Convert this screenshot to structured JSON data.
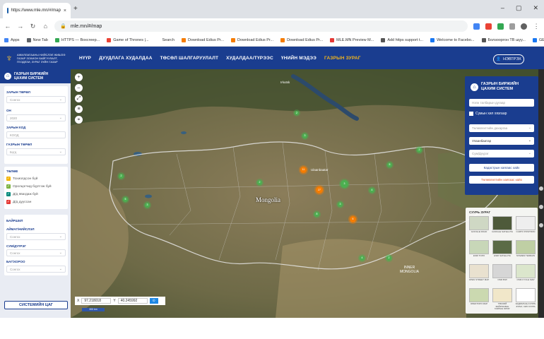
{
  "browser": {
    "tab_title": "https://www.mle.mn/#/map",
    "url": "mle.mn/#/map",
    "new_tab": "+",
    "bookmarks": [
      {
        "label": "Apps",
        "color": "#4285f4"
      },
      {
        "label": "New Tab",
        "color": "#5f6368"
      },
      {
        "label": "HTTPS — Boxcreep...",
        "color": "#34a853"
      },
      {
        "label": "Game of Thrones |...",
        "color": "#ea4335"
      },
      {
        "label": "Search",
        "color": "#ffffff"
      },
      {
        "label": "Download Edius Pr...",
        "color": "#f57c00"
      },
      {
        "label": "Download Edius Pr...",
        "color": "#f57c00"
      },
      {
        "label": "Download Edius Pr...",
        "color": "#f57c00"
      },
      {
        "label": "MLE.MN Preview M...",
        "color": "#e53935"
      },
      {
        "label": "Add https support t...",
        "color": "#555555"
      },
      {
        "label": "Welcome to Facebo...",
        "color": "#1877f2"
      },
      {
        "label": "Болзооргон ТВ шуу...",
        "color": "#555555"
      },
      {
        "label": "GEEKS",
        "color": "#1877f2"
      },
      {
        "label": "Other bookmarks",
        "color": "#f4b400"
      }
    ]
  },
  "site": {
    "logo_lines": [
      "АЖИЛЛАГААНЫ НИЙСЛЭЛ ЖИШЭЭ",
      "ГАЗАР ЗОХИОН БАЙГУУЛАЛТ,",
      "ГЕОДЕЗИ, ЗУРАГ ЗҮЙН ГАЗАР"
    ],
    "nav": [
      {
        "label": "НҮҮР",
        "active": false
      },
      {
        "label": "ДУУДЛАГА ХУДАЛДАА",
        "active": false
      },
      {
        "label": "ТӨСӨЛ ШАЛГАРУУЛАЛТ",
        "active": false
      },
      {
        "label": "ХУДАЛДАА/ТҮРЭЭС",
        "active": false
      },
      {
        "label": "ҮНИЙН МЭДЭЭ",
        "active": false
      },
      {
        "label": "ГАЗРЫН ЗУРАГ",
        "active": true
      }
    ],
    "login_label": "НЭВТРЭХ"
  },
  "sidebar": {
    "title_line1": "ГАЗРЫН БИРЖИЙН",
    "title_line2": "ЦАХИМ СИСТЕМ",
    "filters": [
      {
        "label": "ЗАРЫН ТӨРӨЛ",
        "value": "Сонгох"
      },
      {
        "label": "ОН",
        "value": "2020"
      },
      {
        "label": "ЗАРЫН КОД",
        "value": "КООД"
      },
      {
        "label": "ГАЗРЫН ТӨРӨЛ",
        "value": "Бүгд"
      }
    ],
    "layers_title": "ТӨЛӨВ",
    "layers": [
      {
        "label": "Тохиолдсон бүй",
        "color": "#f4b400"
      },
      {
        "label": "Оролцогчид бүртгэж буй",
        "color": "#7cb342"
      },
      {
        "label": "Д/д явагдаж буй",
        "color": "#00897b"
      },
      {
        "label": "Д/д дууссан",
        "color": "#e53935"
      }
    ],
    "location_title": "БАЙРШИЛ",
    "location_filters": [
      {
        "label": "АЙМАГ/НИЙСЛЭЛ",
        "value": "Сонгох"
      },
      {
        "label": "СУМ/ДҮҮРЭГ",
        "value": "Сонгох"
      },
      {
        "label": "БАГ/ХОРОО",
        "value": "Сонгох"
      }
    ],
    "system_time": "СИСТЕМИЙН ЦАГ"
  },
  "map": {
    "country_label": "Mongolia",
    "capital_label": "Ulaanbaatar",
    "city_label": "Irkutsk",
    "region_label_line1": "INNER",
    "region_label_line2": "MONGOLIA",
    "coord_x_label": "X",
    "coord_x": "97.218018",
    "coord_y_label": "Y",
    "coord_y": "40.245992",
    "scale": "300 km",
    "clusters": [
      {
        "count": "3",
        "color": "#4caf50"
      },
      {
        "count": "2",
        "color": "#4caf50"
      },
      {
        "count": "11",
        "color": "#f57c00"
      },
      {
        "count": "27",
        "color": "#f57c00"
      },
      {
        "count": "3",
        "color": "#4caf50"
      },
      {
        "count": "5",
        "color": "#4caf50"
      },
      {
        "count": "2",
        "color": "#4caf50"
      },
      {
        "count": "4",
        "color": "#4caf50"
      },
      {
        "count": "2",
        "color": "#4caf50"
      },
      {
        "count": "6",
        "color": "#f57c00"
      },
      {
        "count": "3",
        "color": "#4caf50"
      },
      {
        "count": "8",
        "color": "#4caf50"
      },
      {
        "count": "4",
        "color": "#4caf50"
      },
      {
        "count": "2",
        "color": "#4caf50"
      },
      {
        "count": "5",
        "color": "#4caf50"
      },
      {
        "count": "2",
        "color": "#4caf50"
      },
      {
        "count": "3",
        "color": "#4caf50"
      }
    ]
  },
  "search_panel": {
    "title_line1": "ГАЗРЫН БИРЖИЙН",
    "title_line2": "ЦАХИМ СИСТЕМ",
    "query_placeholder": "Нэгж талбарын дугаар",
    "checkbox_label": "Сумын хил хязгаар",
    "province_placeholder": "Төлөвлөлтийн дахаргаа",
    "city_value": "Улаанбаатар",
    "district_placeholder": "Сум/Дүүрэг",
    "button_cadastre": "Кадастрын хаягаас хайх",
    "button_plan": "Төлөвлөлтийн хаягаас хайх"
  },
  "basemaps": {
    "title": "СУУРЬ ЗУРАГ",
    "items": [
      {
        "label": "GOOGLE ROAD",
        "color": "#cfd8c4"
      },
      {
        "label": "GOOGLE SATELLITE",
        "color": "#4e5a3a"
      },
      {
        "label": "CARTO POSITRON",
        "color": "#eeeeee"
      },
      {
        "label": "ESRI TOPO",
        "color": "#c8d7b8"
      },
      {
        "label": "ESRI SATELLITE",
        "color": "#5b6b46"
      },
      {
        "label": "STAMEN TERRAIN",
        "color": "#bfcfa4"
      },
      {
        "label": "OPEN STREET MAP",
        "color": "#e9e1cf"
      },
      {
        "label": "OSM B/W",
        "color": "#d6d6d6"
      },
      {
        "label": "OSM CYCLE MAP",
        "color": "#dbe6cc"
      },
      {
        "label": "OPENTOPO MAP",
        "color": "#cbd9b0"
      },
      {
        "label": "ТӨСЛИЙ БАЙРЛАЛЫН ГАЗРЫН ЗУРАГ",
        "color": "#f1e7c9"
      },
      {
        "label": "ЗАДРАЛСАН СУУРЬ ЗУРАГ, ХИЛ ХУУРЬ",
        "color": "#ffffff"
      }
    ]
  }
}
